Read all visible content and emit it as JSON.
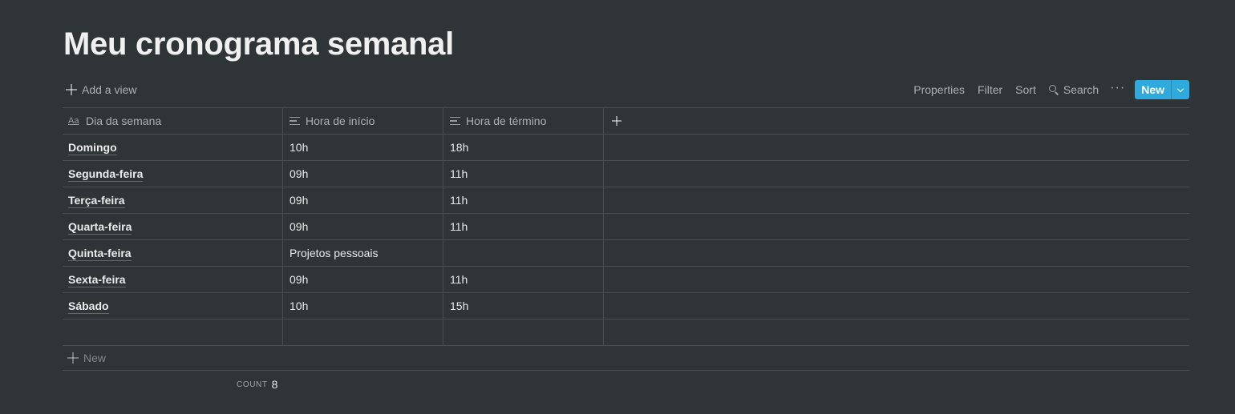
{
  "page": {
    "title": "Meu cronograma semanal"
  },
  "toolbar": {
    "add_view": "Add a view",
    "properties": "Properties",
    "filter": "Filter",
    "sort": "Sort",
    "search": "Search",
    "more": "···",
    "new": "New"
  },
  "table": {
    "columns": [
      "Dia da semana",
      "Hora de início",
      "Hora de término"
    ],
    "rows": [
      {
        "dia": "Domingo",
        "inicio": "10h",
        "termino": "18h"
      },
      {
        "dia": "Segunda-feira",
        "inicio": "09h",
        "termino": "11h"
      },
      {
        "dia": "Terça-feira",
        "inicio": "09h",
        "termino": "11h"
      },
      {
        "dia": "Quarta-feira",
        "inicio": "09h",
        "termino": "11h"
      },
      {
        "dia": "Quinta-feira",
        "inicio": "Projetos pessoais",
        "termino": ""
      },
      {
        "dia": "Sexta-feira",
        "inicio": "09h",
        "termino": "11h"
      },
      {
        "dia": "Sábado",
        "inicio": "10h",
        "termino": "15h"
      },
      {
        "dia": "",
        "inicio": "",
        "termino": ""
      }
    ],
    "new_row_label": "New",
    "count_label": "COUNT",
    "count_value": "8"
  },
  "colors": {
    "background": "#2f3437",
    "accent": "#2eaadc"
  }
}
